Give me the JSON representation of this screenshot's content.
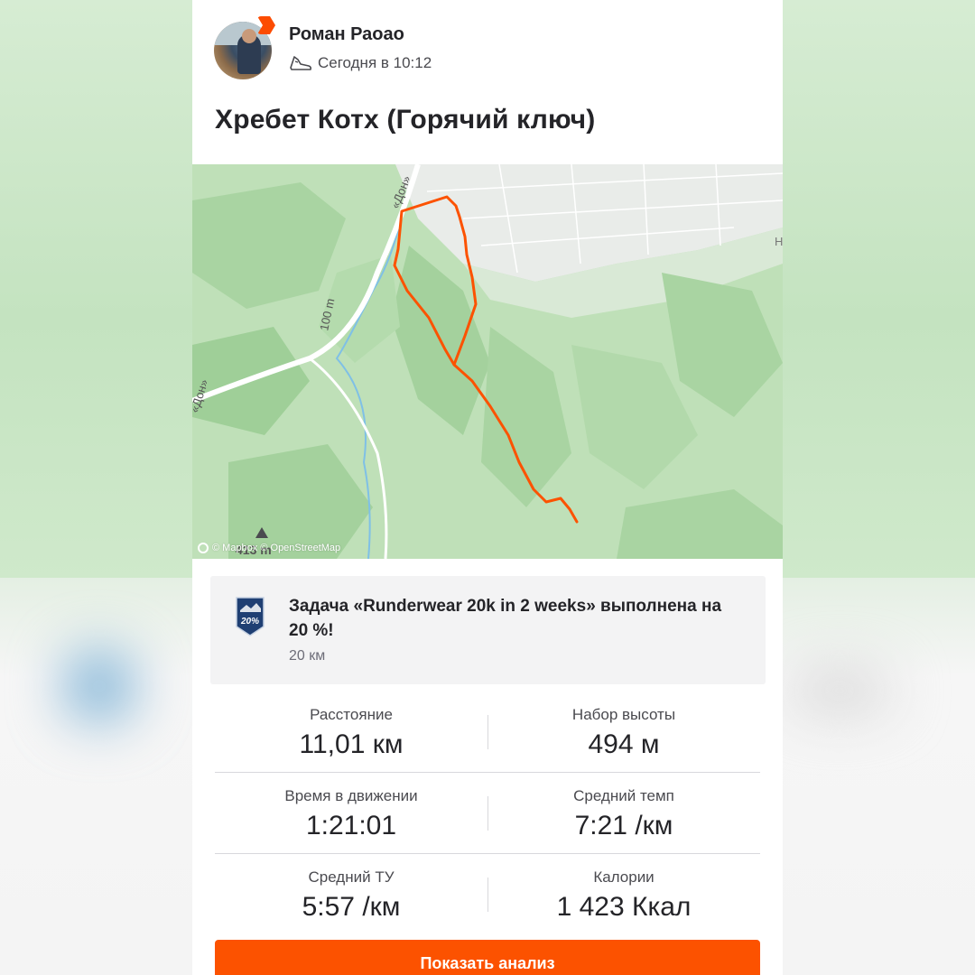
{
  "post": {
    "author": "Роман Раоао",
    "time": "Сегодня в 10:12",
    "title": "Хребет Котх (Горячий ключ)"
  },
  "map": {
    "road_label_top": "«Дон»",
    "road_label_left": "«Дон»",
    "scale_label": "100 m",
    "peak_label": "413 m",
    "attribution": "© Mapbox © OpenStreetMap",
    "edge_label": "Н",
    "route_color": "#fc5200"
  },
  "challenge": {
    "text": "Задача «Runderwear 20k in 2 weeks» выполнена на 20 %!",
    "subtext": "20 км",
    "badge_text": "20%"
  },
  "stats": [
    {
      "left": {
        "label": "Расстояние",
        "value": "11,01 км"
      },
      "right": {
        "label": "Набор высоты",
        "value": "494 м"
      }
    },
    {
      "left": {
        "label": "Время в движении",
        "value": "1:21:01"
      },
      "right": {
        "label": "Средний темп",
        "value": "7:21 /км"
      }
    },
    {
      "left": {
        "label": "Средний ТУ",
        "value": "5:57 /км"
      },
      "right": {
        "label": "Калории",
        "value": "1 423 Ккал"
      }
    }
  ],
  "actions": {
    "analysis": "Показать анализ"
  },
  "colors": {
    "accent": "#fc5200",
    "text": "#242428",
    "map_green": "#bfe0b8"
  }
}
